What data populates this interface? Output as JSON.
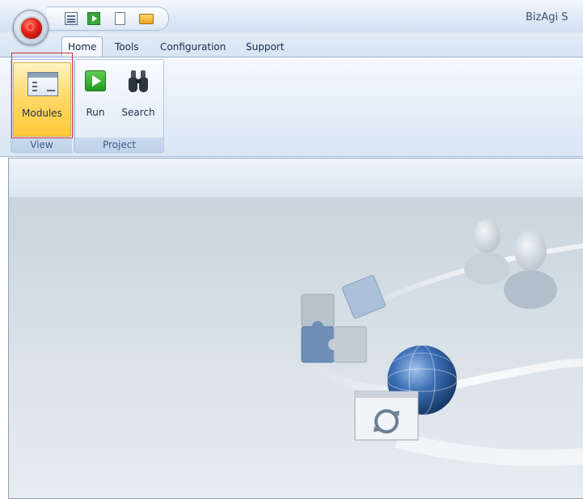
{
  "app": {
    "title": "BizAgi S"
  },
  "quick_access": {
    "icons": [
      "modules-icon",
      "run-icon",
      "new-document-icon",
      "open-folder-icon"
    ]
  },
  "tabs": [
    {
      "label": "Home",
      "active": true
    },
    {
      "label": "Tools"
    },
    {
      "label": "Configuration"
    },
    {
      "label": "Support"
    }
  ],
  "ribbon": {
    "groups": [
      {
        "label": "View",
        "buttons": [
          {
            "label": "Modules",
            "icon": "modules-icon",
            "selected": true
          }
        ]
      },
      {
        "label": "Project",
        "buttons": [
          {
            "label": "Run",
            "icon": "play-icon"
          },
          {
            "label": "Search",
            "icon": "binoculars-icon"
          }
        ]
      }
    ]
  },
  "colors": {
    "highlight_border": "#d1323c",
    "selected_button": "#ffd96a",
    "run_green": "#2fa12f"
  }
}
